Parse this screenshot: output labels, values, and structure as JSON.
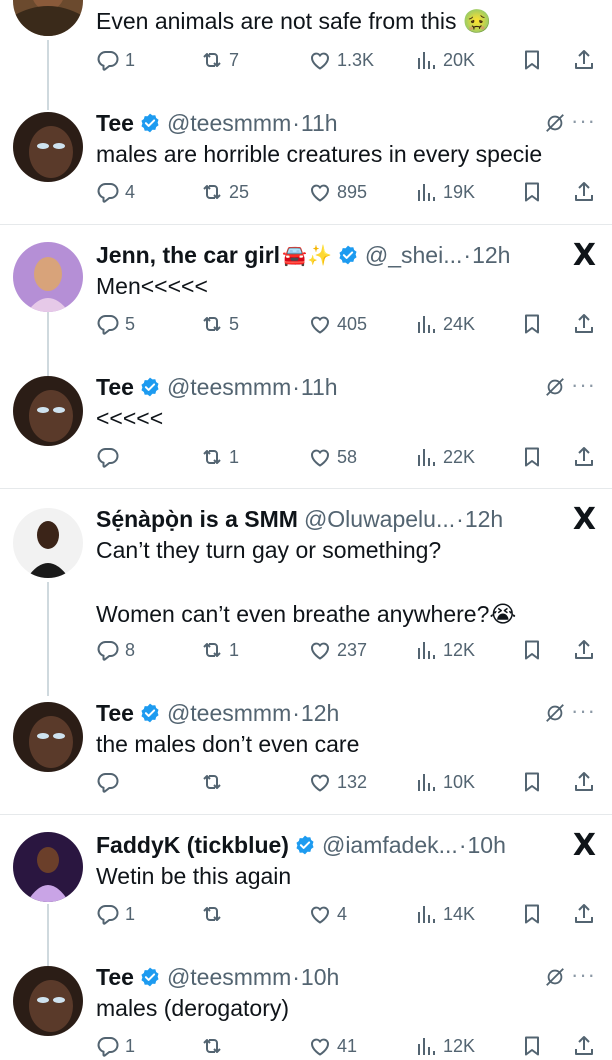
{
  "tweets": [
    {
      "name": "",
      "handle": "",
      "time": "",
      "text": "Even animals are not safe from this 🤢",
      "replies": "1",
      "retweets": "7",
      "likes": "1.3K",
      "views": "20K"
    },
    {
      "name": "Tee",
      "handle": "@teesmmm",
      "time": "11h",
      "text": "males are horrible creatures in every specie",
      "replies": "4",
      "retweets": "25",
      "likes": "895",
      "views": "19K"
    },
    {
      "name": "Jenn, the car girl",
      "emoji": "🚘✨",
      "handle": "@_shei...",
      "time": "12h",
      "text": "Men<<<<<",
      "replies": "5",
      "retweets": "5",
      "likes": "405",
      "views": "24K"
    },
    {
      "name": "Tee",
      "handle": "@teesmmm",
      "time": "11h",
      "text": "<<<<<",
      "replies": "",
      "retweets": "1",
      "likes": "58",
      "views": "22K"
    },
    {
      "name": "Sẹ́nàpọ̀n is a SMM",
      "handle": "@Oluwapelu...",
      "time": "12h",
      "text": "Can’t they turn gay or something?\n\nWomen can’t even breathe anywhere?😭",
      "replies": "8",
      "retweets": "1",
      "likes": "237",
      "views": "12K"
    },
    {
      "name": "Tee",
      "handle": "@teesmmm",
      "time": "12h",
      "text": "the males don’t even care",
      "replies": "",
      "retweets": "",
      "likes": "132",
      "views": "10K"
    },
    {
      "name": "FaddyK (tickblue)",
      "handle": "@iamfadek...",
      "time": "10h",
      "text": "Wetin be this again",
      "replies": "1",
      "retweets": "",
      "likes": "4",
      "views": "14K"
    },
    {
      "name": "Tee",
      "handle": "@teesmmm",
      "time": "10h",
      "text": "males (derogatory)",
      "replies": "1",
      "retweets": "",
      "likes": "41",
      "views": "12K"
    }
  ],
  "symbols": {
    "dot": "·",
    "more": "···",
    "x_logo": "X"
  },
  "colors": {
    "text": "#0f1419",
    "secondary": "#536471",
    "verified": "#1d9bf0",
    "divider": "#e6e9eb",
    "thread_line": "#cfd9de"
  },
  "icons": [
    "reply-icon",
    "retweet-icon",
    "like-icon",
    "views-icon",
    "bookmark-icon",
    "share-icon",
    "verified-icon",
    "grok-icon",
    "more-icon",
    "x-logo-icon"
  ]
}
